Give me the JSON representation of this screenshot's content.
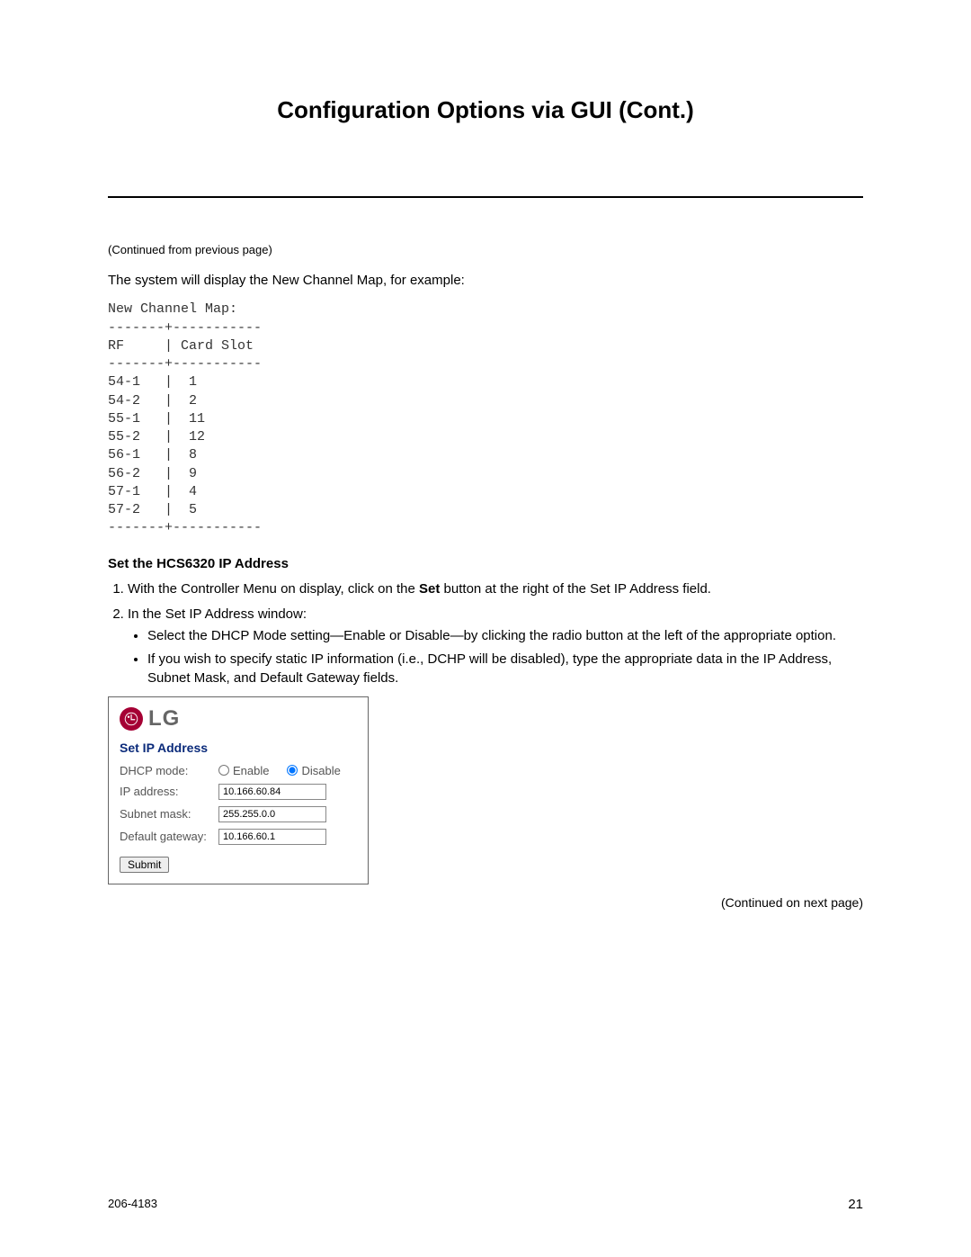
{
  "title": "Configuration Options via GUI (Cont.)",
  "continued_top": "(Continued from previous page)",
  "intro": "The system will display the New Channel Map, for example:",
  "channel_map_text": "New Channel Map:\n-------+-----------\nRF     | Card Slot\n-------+-----------\n54-1   |  1\n54-2   |  2\n55-1   |  11\n55-2   |  12\n56-1   |  8\n56-2   |  9\n57-1   |  4\n57-2   |  5\n-------+-----------",
  "chart_data": {
    "type": "table",
    "title": "New Channel Map",
    "columns": [
      "RF",
      "Card Slot"
    ],
    "rows": [
      [
        "54-1",
        1
      ],
      [
        "54-2",
        2
      ],
      [
        "55-1",
        11
      ],
      [
        "55-2",
        12
      ],
      [
        "56-1",
        8
      ],
      [
        "56-2",
        9
      ],
      [
        "57-1",
        4
      ],
      [
        "57-2",
        5
      ]
    ]
  },
  "section_heading": "Set the HCS6320 IP Address",
  "step1_prefix": "With the Controller Menu on display, click on the ",
  "step1_bold": "Set",
  "step1_suffix": " button at the right of the Set IP Address field.",
  "step2": "In the Set IP Address window:",
  "bullet1": "Select the DHCP Mode setting—Enable or Disable—by clicking the radio button at the left of the appropriate option.",
  "bullet2": "If you wish to specify static IP information (i.e., DCHP will be disabled), type the appropriate data in the IP Address, Subnet Mask, and Default Gateway fields.",
  "dialog": {
    "logo_text": "LG",
    "title": "Set IP Address",
    "dhcp_label": "DHCP mode:",
    "enable_label": "Enable",
    "disable_label": "Disable",
    "dhcp_selected": "disable",
    "ip_label": "IP address:",
    "ip_value": "10.166.60.84",
    "subnet_label": "Subnet mask:",
    "subnet_value": "255.255.0.0",
    "gateway_label": "Default gateway:",
    "gateway_value": "10.166.60.1",
    "submit_label": "Submit"
  },
  "continued_bottom": "(Continued on next page)",
  "footer_left": "206-4183",
  "footer_right": "21"
}
